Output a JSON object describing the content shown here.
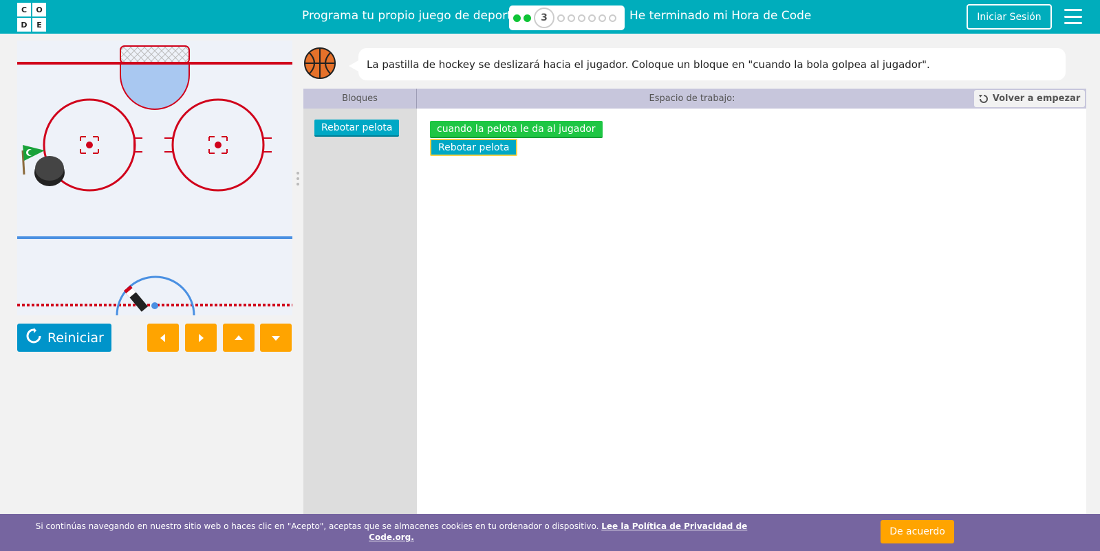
{
  "header": {
    "logo_letters": [
      "C",
      "O",
      "D",
      "E"
    ],
    "level_title": "Programa tu propio juego de deporte",
    "current_level": "3",
    "completed_levels": 2,
    "remaining_levels": 6,
    "finish_link": "He terminado mi Hora de Code",
    "signin_label": "Iniciar Sesión",
    "menu_icon": "hamburger-menu-icon"
  },
  "colors": {
    "header_bg": "#00adbc",
    "accent_orange": "#ffa400",
    "reset_blue": "#0094ca",
    "cookie_bg": "#7665a0",
    "block_cyan": "#00a8c5",
    "block_green": "#1ec644"
  },
  "game": {
    "reset_label": "Reiniciar",
    "reset_icon": "refresh-icon",
    "arrow_buttons": [
      "left-arrow-icon",
      "right-arrow-icon",
      "up-arrow-icon",
      "down-arrow-icon"
    ]
  },
  "instructions": {
    "avatar_icon": "basketball-icon",
    "text": "La pastilla de hockey se deslizará hacia el jugador. Coloque un bloque en \"cuando la bola golpea al jugador\"."
  },
  "workspace": {
    "toolbox_label": "Bloques",
    "workspace_label": "Espacio de trabajo:",
    "restart_label": "Volver a empezar",
    "toolbox_blocks": [
      "Rebotar pelota"
    ],
    "event_block": "cuando la pelota le da al jugador",
    "action_block": "Rebotar pelota"
  },
  "cookie": {
    "text": "Si continúas navegando en nuestro sitio web o haces clic en \"Acepto\", aceptas que se almacenes cookies en tu ordenador o dispositivo.",
    "link": "Lee la Política de Privacidad de Code.org.",
    "accept_label": "De acuerdo"
  }
}
